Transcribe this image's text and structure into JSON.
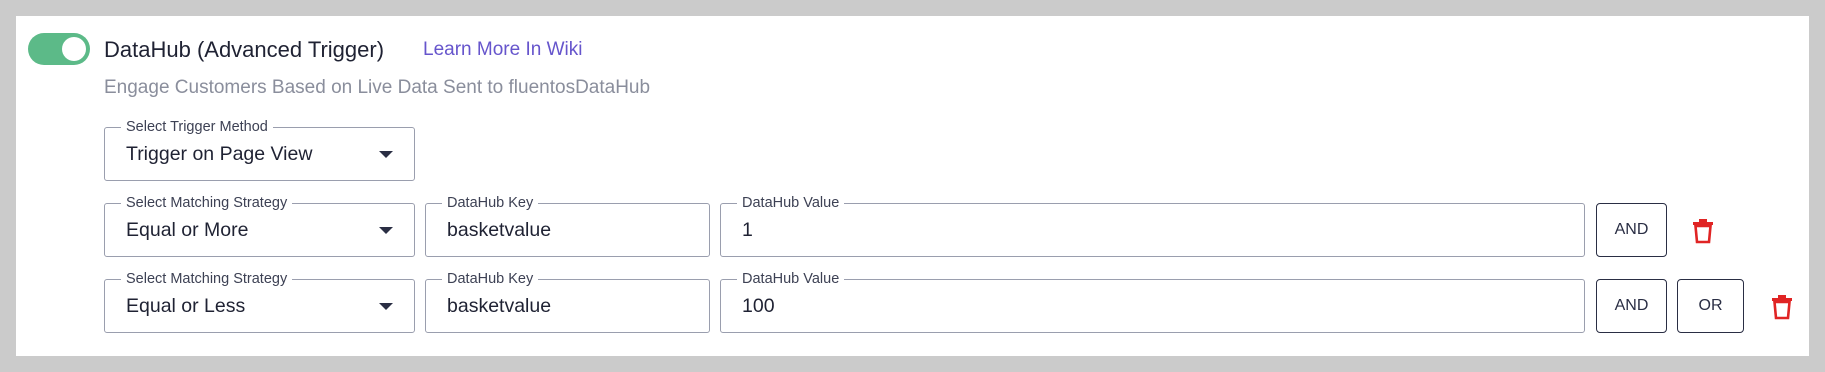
{
  "header": {
    "title": "DataHub (Advanced Trigger)",
    "learn_more_link": "Learn More In Wiki",
    "subtitle": "Engage Customers Based on Live Data Sent to fluentosDataHub",
    "enabled": true
  },
  "trigger_method": {
    "label": "Select Trigger Method",
    "value": "Trigger on Page View"
  },
  "conditions": [
    {
      "strategy_label": "Select Matching Strategy",
      "strategy_value": "Equal or More",
      "key_label": "DataHub Key",
      "key_value": "basketvalue",
      "value_label": "DataHub Value",
      "value_value": "1",
      "buttons": [
        "AND"
      ]
    },
    {
      "strategy_label": "Select Matching Strategy",
      "strategy_value": "Equal or Less",
      "key_label": "DataHub Key",
      "key_value": "basketvalue",
      "value_label": "DataHub Value",
      "value_value": "100",
      "buttons": [
        "AND",
        "OR"
      ]
    }
  ],
  "icons": {
    "delete": "trash-icon",
    "dropdown": "chevron-down-icon"
  },
  "colors": {
    "toggle_on": "#5cba88",
    "link": "#6655cc",
    "delete": "#e02424",
    "background": "#cbcbcb"
  }
}
